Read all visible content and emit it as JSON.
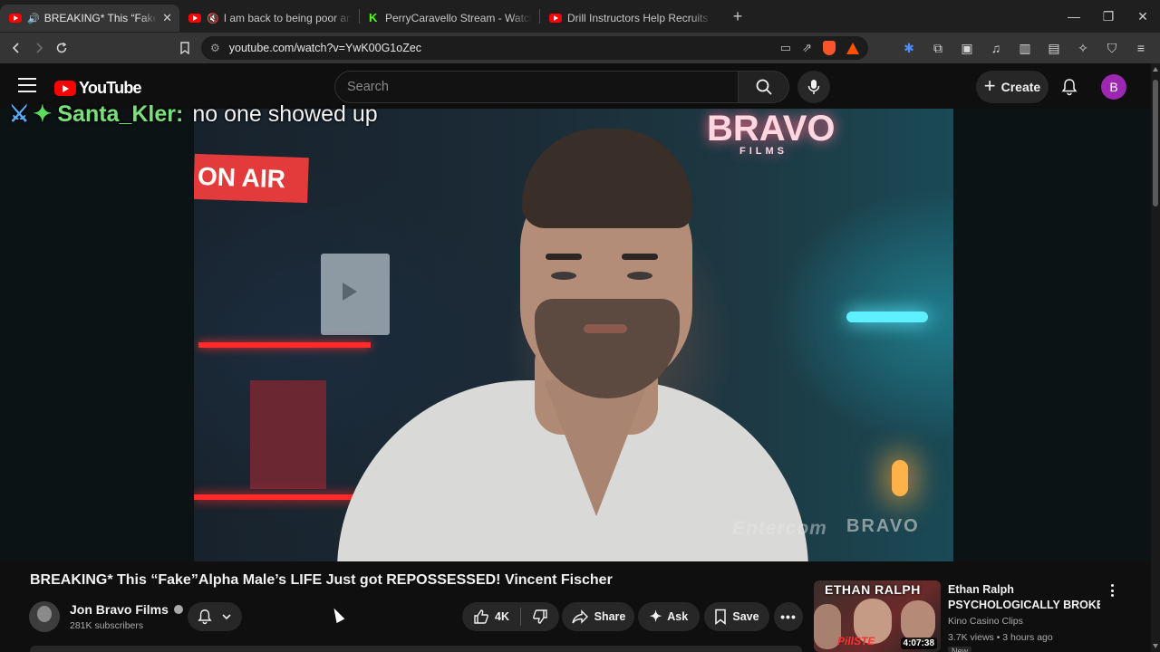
{
  "browser": {
    "tabs": [
      {
        "title": "BREAKING* This “Fake”Alpha",
        "active": true,
        "audio": true,
        "favicon": "youtube-icon"
      },
      {
        "title": "I am back to being poor and its a",
        "active": false,
        "audio": true,
        "muted": true,
        "favicon": "youtube-icon"
      },
      {
        "title": "PerryCaravello Stream - Watch Live o",
        "active": false,
        "audio": false,
        "favicon": "kick-icon"
      },
      {
        "title": "Drill Instructors Help Recruits Develo",
        "active": false,
        "audio": false,
        "favicon": "youtube-icon"
      }
    ],
    "new_tab": "+",
    "url": "youtube.com/watch?v=YwK00G1oZec"
  },
  "youtube": {
    "logo_text": "YouTube",
    "search_placeholder": "Search",
    "create_label": "Create",
    "avatar_letter": "B",
    "brand_color": "#ff0000",
    "avatar_color": "#9c27b0"
  },
  "video": {
    "chat_overlay": {
      "user": "Santa_Kler:",
      "message": "no one showed up"
    },
    "scene": {
      "on_air_sign": "ON AIR",
      "bravo_sign": "BRAVO",
      "bravo_sub": "FILMS",
      "watermark_a": "Entercom",
      "watermark_b": "BRAVO"
    },
    "title": "BREAKING* This “Fake”Alpha Male’s LIFE Just got REPOSSESSED! Vincent Fischer",
    "channel": {
      "name": "Jon Bravo Films",
      "subscribers": "281K subscribers"
    },
    "actions": {
      "likes": "4K",
      "share": "Share",
      "ask": "Ask",
      "save": "Save"
    }
  },
  "recommended": [
    {
      "thumb_text": "ETHAN RALPH",
      "thumb_brand": "PillSTE",
      "duration": "4:07:38",
      "title_line1": "Ethan Ralph",
      "title_line2": "PSYCHOLOGICALLY BROKEN ...",
      "channel": "Kino Casino Clips",
      "meta": "3.7K views • 3 hours ago",
      "badge": "New"
    }
  ]
}
